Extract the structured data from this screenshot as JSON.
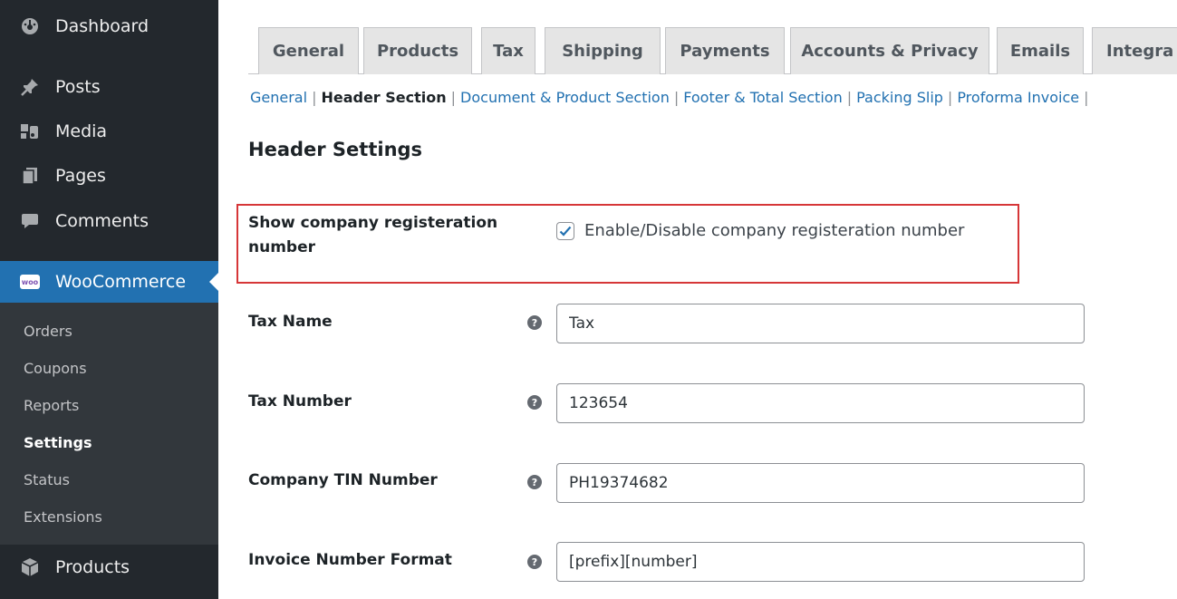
{
  "sidebar": {
    "menu": [
      {
        "label": "Dashboard",
        "icon": "dashboard-icon"
      },
      {
        "label": "Posts",
        "icon": "pin-icon"
      },
      {
        "label": "Media",
        "icon": "media-icon"
      },
      {
        "label": "Pages",
        "icon": "pages-icon"
      },
      {
        "label": "Comments",
        "icon": "comment-icon"
      },
      {
        "label": "WooCommerce",
        "icon": "woo-icon"
      },
      {
        "label": "Products",
        "icon": "box-icon"
      }
    ],
    "woo_icon_text": "woo",
    "submenu": [
      "Orders",
      "Coupons",
      "Reports",
      "Settings",
      "Status",
      "Extensions"
    ],
    "current_submenu": "Settings"
  },
  "tabs": [
    "General",
    "Products",
    "Tax",
    "Shipping",
    "Payments",
    "Accounts & Privacy",
    "Emails",
    "Integra"
  ],
  "subnav": {
    "items": [
      "General",
      "Header Section",
      "Document & Product Section",
      "Footer & Total Section",
      "Packing Slip",
      "Proforma Invoice"
    ],
    "current": "Header Section",
    "separator": "|"
  },
  "page_title": "Header Settings",
  "checkbox_row": {
    "label_line1": "Show company registeration",
    "label_line2": "number",
    "checkbox_label": "Enable/Disable company registeration number",
    "checked": true
  },
  "fields": [
    {
      "label": "Tax Name",
      "value": "Tax"
    },
    {
      "label": "Tax Number",
      "value": "123654"
    },
    {
      "label": "Company TIN Number",
      "value": "PH19374682"
    },
    {
      "label": "Invoice Number Format",
      "value": "[prefix][number]"
    }
  ],
  "help_glyph": "?",
  "colors": {
    "sidebar_bg": "#23282d",
    "submenu_bg": "#32373c",
    "accent": "#2271b1",
    "highlight_border": "#d63638"
  }
}
